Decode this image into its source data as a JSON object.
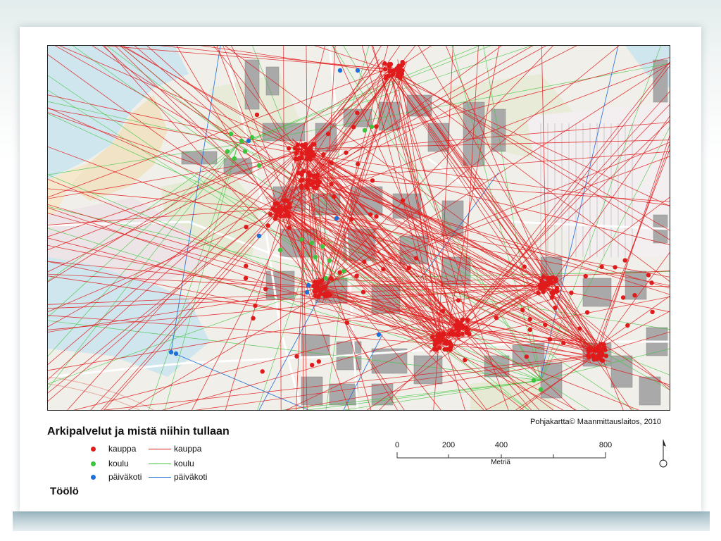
{
  "map": {
    "title": "Arkipalvelut ja mistä niihin tullaan",
    "area_label": "Töölö",
    "credit": "Pohjakartta© Maanmittauslaitos, 2010",
    "legend": [
      {
        "point_label": "kauppa",
        "line_label": "kauppa",
        "color": "#e01b1b"
      },
      {
        "point_label": "koulu",
        "line_label": "koulu",
        "color": "#3cc43c"
      },
      {
        "point_label": "päiväkoti",
        "line_label": "päiväkoti",
        "color": "#1f6fd8"
      }
    ],
    "scale": {
      "ticks": [
        "0",
        "200",
        "400",
        "800"
      ],
      "unit": "Metriä"
    }
  }
}
